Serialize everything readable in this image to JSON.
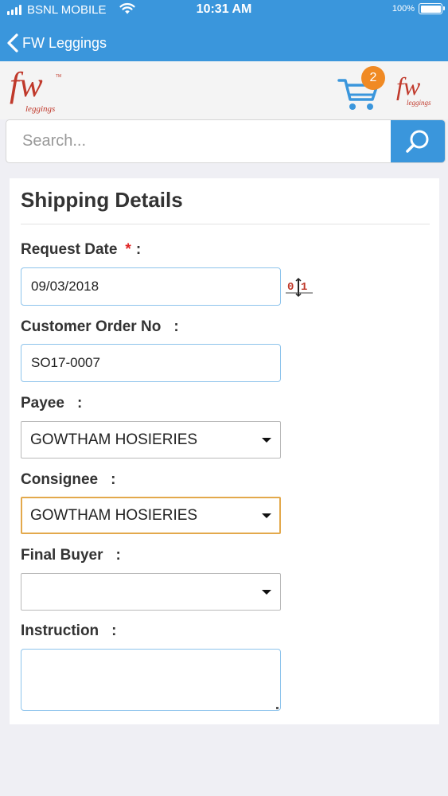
{
  "status_bar": {
    "carrier": "BSNL MOBILE",
    "time": "10:31 AM",
    "battery": "100%"
  },
  "nav": {
    "title": "FW Leggings"
  },
  "header": {
    "logo_text": "fw",
    "logo_subtext": "leggings",
    "cart_count": "2"
  },
  "search": {
    "placeholder": "Search..."
  },
  "form": {
    "title": "Shipping Details",
    "request_date": {
      "label": "Request Date",
      "required_mark": "*",
      "colon": ":",
      "value": "09/03/2018"
    },
    "date_picker_icon": {
      "digit_a": "0",
      "digit_b": "1"
    },
    "customer_order_no": {
      "label": "Customer Order No",
      "colon": ":",
      "value": "SO17-0007"
    },
    "payee": {
      "label": "Payee",
      "colon": ":",
      "value": "GOWTHAM HOSIERIES"
    },
    "consignee": {
      "label": "Consignee",
      "colon": ":",
      "value": "GOWTHAM HOSIERIES"
    },
    "final_buyer": {
      "label": "Final Buyer",
      "colon": ":",
      "value": ""
    },
    "instruction": {
      "label": "Instruction",
      "colon": ":",
      "value": ""
    }
  },
  "colors": {
    "primary": "#3a96dc",
    "badge": "#f08a24",
    "required": "#e02424",
    "brand_red": "#c0392b",
    "focus_border": "#e3a94c"
  }
}
